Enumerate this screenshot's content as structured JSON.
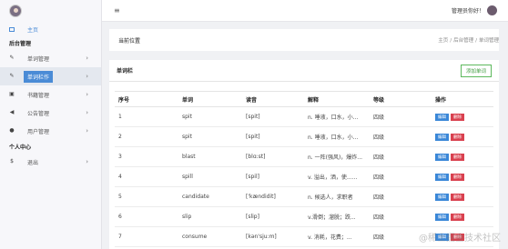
{
  "sidebar": {
    "home_label": "主页",
    "section_admin": "后台管理",
    "items": [
      {
        "label": "单词管理",
        "icon": "edit-icon"
      },
      {
        "label": "单词栏作",
        "icon": "edit-icon"
      },
      {
        "label": "书籍管理",
        "icon": "book-icon"
      },
      {
        "label": "公告管理",
        "icon": "megaphone-icon"
      },
      {
        "label": "用户管理",
        "icon": "user-icon"
      }
    ],
    "section_personal": "个人中心",
    "personal_items": [
      {
        "label": "退出",
        "icon": "dollar-icon"
      }
    ]
  },
  "topbar": {
    "menu_icon": "hamburger-icon",
    "greeting": "管理员你好！"
  },
  "breadcrumb": {
    "title": "当前位置",
    "path": [
      "主页",
      "后台管理",
      "单词管理"
    ]
  },
  "panel": {
    "title": "单词栏",
    "add_button": "添加单词"
  },
  "table": {
    "headers": [
      "序号",
      "单词",
      "读音",
      "解释",
      "等级",
      "操作"
    ],
    "rows": [
      {
        "id": "1",
        "word": "spit",
        "phonetic": "[spit]",
        "meaning": "n. 唾液，口水，小...",
        "level": "四级"
      },
      {
        "id": "2",
        "word": "spit",
        "phonetic": "[spit]",
        "meaning": "n. 唾液，口水，小...",
        "level": "四级"
      },
      {
        "id": "3",
        "word": "blast",
        "phonetic": "[blɑ:st]",
        "meaning": "n. 一阵(强风)，爆炸...",
        "level": "四级"
      },
      {
        "id": "4",
        "word": "spill",
        "phonetic": "[spil]",
        "meaning": "v. 溢出，洒，使......",
        "level": "四级"
      },
      {
        "id": "5",
        "word": "candidate",
        "phonetic": "['kændidit]",
        "meaning": "n. 候选人，求职者",
        "level": "四级"
      },
      {
        "id": "6",
        "word": "slip",
        "phonetic": "[slip]",
        "meaning": "v.滑倒；溜脱；跌...",
        "level": "四级"
      },
      {
        "id": "7",
        "word": "consume",
        "phonetic": "[kən'sju:m]",
        "meaning": "v. 消耗，花费；...",
        "level": "四级"
      }
    ],
    "edit_label": "编辑",
    "delete_label": "删除"
  },
  "watermark": "@稀土掘金技术社区"
}
